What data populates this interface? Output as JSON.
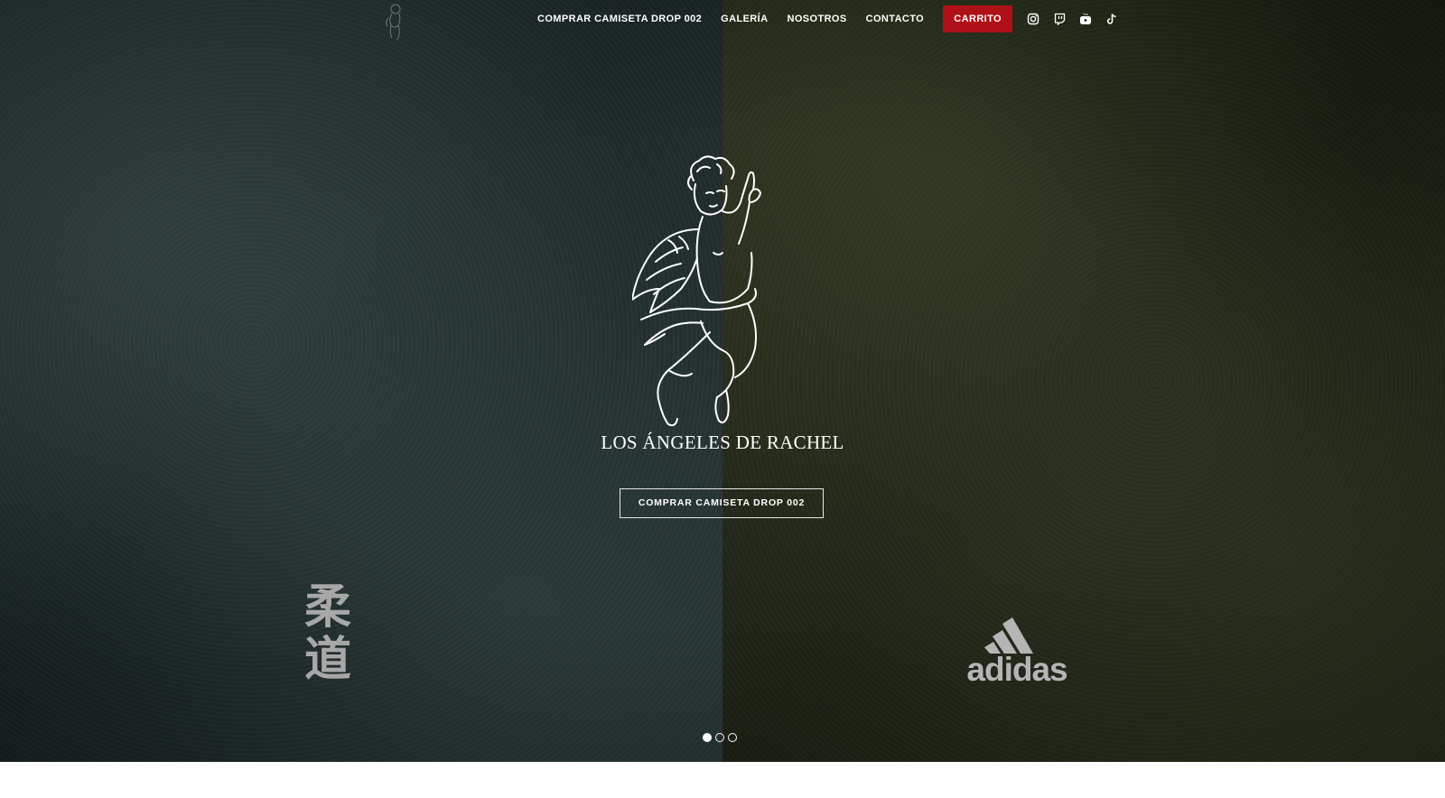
{
  "nav": {
    "links": [
      {
        "label": "COMPRAR CAMISETA DROP 002"
      },
      {
        "label": "GALERÍA"
      },
      {
        "label": "NOSOTROS"
      },
      {
        "label": "CONTACTO"
      }
    ],
    "cart_label": "CARRITO",
    "social_icons": [
      "instagram-icon",
      "twitch-icon",
      "youtube-icon",
      "tiktok-icon"
    ]
  },
  "hero": {
    "title": "LOS ÁNGELES DE RACHEL",
    "cta_label": "COMPRAR CAMISETA DROP 002",
    "left_logo_text": "柔道",
    "right_logo_text": "adidas",
    "slides": {
      "count": 3,
      "active_index": 0
    }
  },
  "colors": {
    "accent": "#b01017",
    "text": "#ffffff",
    "left_panel": "#263433",
    "right_panel": "#252c1b"
  }
}
